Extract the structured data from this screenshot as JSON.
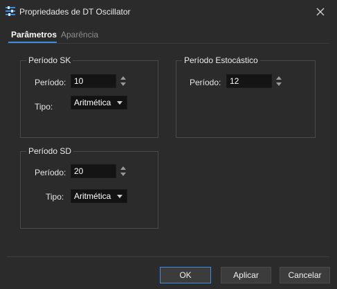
{
  "window": {
    "title": "Propriedades de DT Oscillator",
    "icon": "settings-sliders-icon",
    "close_icon": "close-icon"
  },
  "tabs": [
    {
      "label": "Parâmetros",
      "active": true
    },
    {
      "label": "Aparência",
      "active": false
    }
  ],
  "groups": {
    "sk": {
      "title": "Período SK",
      "periodo_label": "Período:",
      "periodo_value": "10",
      "tipo_label": "Tipo:",
      "tipo_value": "Aritmética"
    },
    "estocastico": {
      "title": "Período Estocástico",
      "periodo_label": "Período:",
      "periodo_value": "12"
    },
    "sd": {
      "title": "Período SD",
      "periodo_label": "Período:",
      "periodo_value": "20",
      "tipo_label": "Tipo:",
      "tipo_value": "Aritmética"
    }
  },
  "buttons": {
    "ok": "OK",
    "apply": "Aplicar",
    "cancel": "Cancelar"
  },
  "colors": {
    "background": "#2b2b2b",
    "accent": "#3a8ee6",
    "input_bg": "#141414"
  }
}
